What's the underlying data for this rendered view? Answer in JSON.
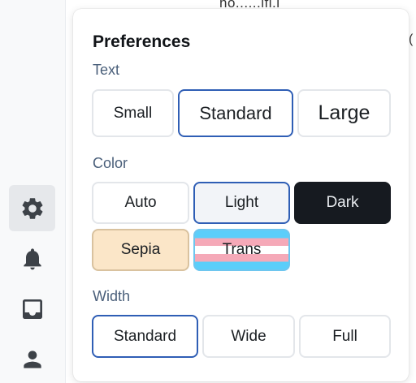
{
  "background": {
    "partial_text": "ho......ifi.l",
    "edge_glyph": "("
  },
  "sidebar": {
    "items": [
      {
        "icon": "gear-icon",
        "active": true
      },
      {
        "icon": "bell-icon",
        "active": false
      },
      {
        "icon": "inbox-icon",
        "active": false
      },
      {
        "icon": "user-icon",
        "active": false
      }
    ]
  },
  "preferences": {
    "title": "Preferences",
    "text": {
      "label": "Text",
      "options": [
        "Small",
        "Standard",
        "Large"
      ],
      "selected": "Standard"
    },
    "color": {
      "label": "Color",
      "options": [
        "Auto",
        "Light",
        "Dark",
        "Sepia",
        "Trans"
      ],
      "selected": "Light"
    },
    "width": {
      "label": "Width",
      "options": [
        "Standard",
        "Wide",
        "Full"
      ],
      "selected": "Standard"
    }
  },
  "colors": {
    "selected_border": "#2f5eb5",
    "dark_bg": "#161a20",
    "sepia_bg": "#fbe6c8",
    "light_bg": "#f2f4f8"
  }
}
